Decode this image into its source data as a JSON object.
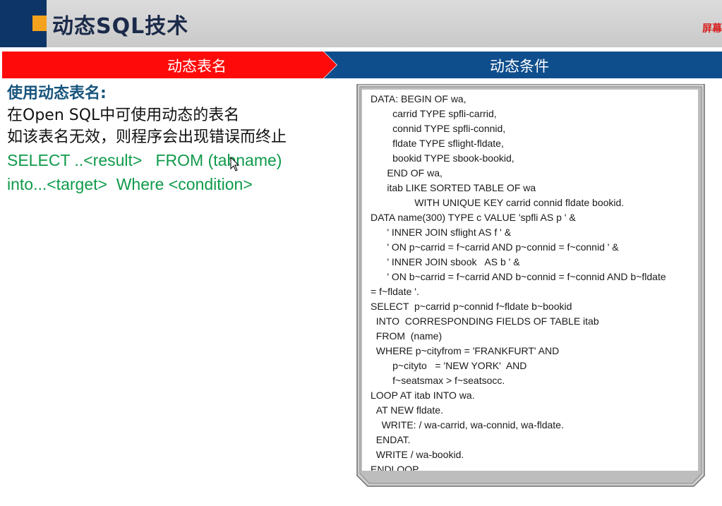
{
  "header": {
    "title": "动态SQL技术",
    "corner_text": "屏幕"
  },
  "tabs": [
    {
      "label": "动态表名",
      "color": "#ff0a0a"
    },
    {
      "label": "动态条件",
      "color": "#0f4e8c"
    }
  ],
  "content": {
    "heading": "使用动态表名:",
    "lines": [
      "在Open SQL中可使用动态的表名",
      "如该表名无效，则程序会出现错误而终止"
    ],
    "syntax": [
      "SELECT ..<result>   FROM (tabname)",
      "into...<target>  Where <condition>"
    ]
  },
  "code_lines": [
    "DATA: BEGIN OF wa,",
    "        carrid TYPE spfli-carrid,",
    "        connid TYPE spfli-connid,",
    "        fldate TYPE sflight-fldate,",
    "        bookid TYPE sbook-bookid,",
    "      END OF wa,",
    "      itab LIKE SORTED TABLE OF wa",
    "                WITH UNIQUE KEY carrid connid fldate bookid.",
    "DATA name(300) TYPE c VALUE 'spfli AS p ' &",
    "      ' INNER JOIN sflight AS f ' &",
    "      ' ON p~carrid = f~carrid AND p~connid = f~connid ' &",
    "      ' INNER JOIN sbook   AS b ' &",
    "      ' ON b~carrid = f~carrid AND b~connid = f~connid AND b~fldate",
    "= f~fldate '.",
    "SELECT  p~carrid p~connid f~fldate b~bookid",
    "  INTO  CORRESPONDING FIELDS OF TABLE itab",
    "  FROM  (name)",
    "  WHERE p~cityfrom = 'FRANKFURT' AND",
    "        p~cityto   = 'NEW YORK'  AND",
    "        f~seatsmax > f~seatsocc.",
    "LOOP AT itab INTO wa.",
    "  AT NEW fldate.",
    "    WRITE: / wa-carrid, wa-connid, wa-fldate.",
    "  ENDAT.",
    "  WRITE / wa-bookid.",
    "ENDLOOP."
  ]
}
